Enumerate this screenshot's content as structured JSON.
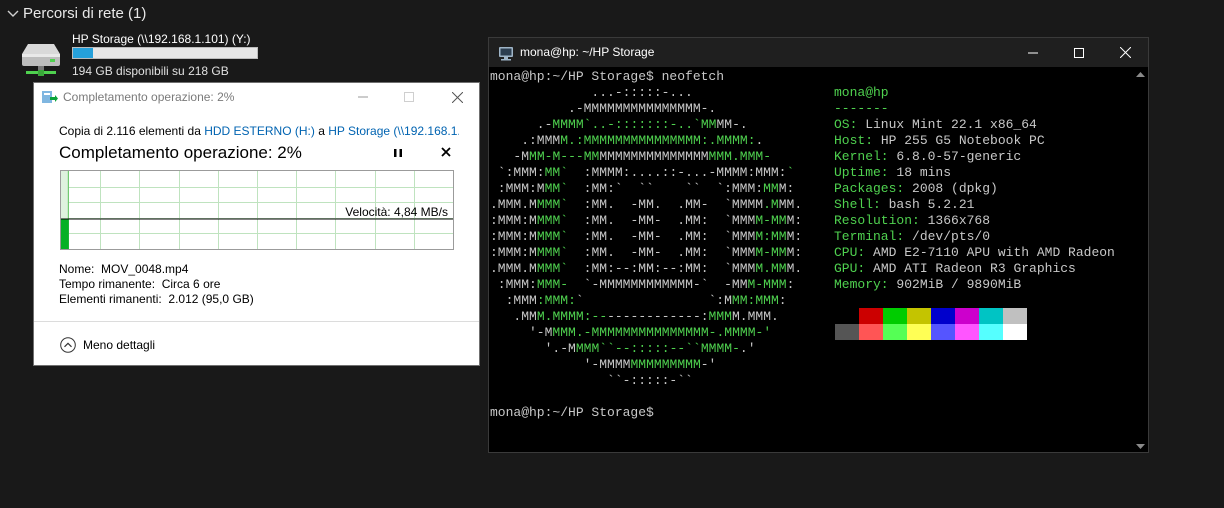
{
  "explorer": {
    "section_title": "Percorsi di rete (1)",
    "drive": {
      "name": "HP Storage (\\\\192.168.1.101) (Y:)",
      "free_text": "194 GB disponibili su 218 GB",
      "used_fraction": 0.11,
      "bar_color": "#26a0da"
    }
  },
  "copy_dialog": {
    "title": "Completamento operazione: 2%",
    "copy_prefix": "Copia di 2.116 elementi da ",
    "source": "HDD ESTERNO (H:)",
    "middle": " a ",
    "destination": "HP Storage (\\\\192.168.1....",
    "progress_title": "Completamento operazione: 2%",
    "progress_percent": 2,
    "speed": "Velocità: 4,84 MB/s",
    "details": {
      "name_label": "Nome:",
      "name_value": "MOV_0048.mp4",
      "time_label": "Tempo rimanente:",
      "time_value": "Circa 6 ore",
      "items_label": "Elementi rimanenti:",
      "items_value": "2.012 (95,0 GB)"
    },
    "less_details": "Meno dettagli",
    "graph_color": "#06b025"
  },
  "terminal": {
    "title": "mona@hp: ~/HP Storage",
    "prompt": "mona@hp:~/HP Storage$",
    "command": " neofetch",
    "logo": [
      "             ...-:::::-...",
      "          .-MMMMMMMMMMMMMMM-.",
      "      .-MMMM`..-:::::::-..`MMMM-.",
      "    .:MMMM.:MMMMMMMMMMMMMMM:.MMMM:.",
      "   -MMM-M---MMMMMMMMMMMMMMMMMMM.MMM-",
      " `:MMM:MM`  :MMMM:....::-...-MMMM:MMM:`",
      " :MMM:MMM`  :MM:`  ``    ``  `:MMM:MMM:",
      ".MMM.MMMM`  :MM.  -MM.  .MM-  `MMMM.MMM.",
      ":MMM:MMMM`  :MM.  -MM-  .MM:  `MMMM-MMM:",
      ":MMM:MMMM`  :MM.  -MM-  .MM:  `MMMM:MMM:",
      ":MMM:MMMM`  :MM.  -MM-  .MM:  `MMMM-MMM:",
      ".MMM.MMMM`  :MM:--:MM:--:MM:  `MMMM.MMM.",
      " :MMM:MMM-  `-MMMMMMMMMMMM-`  -MMM-MMM:",
      "  :MMM:MMM:`                `:MMM:MMM:",
      "   .MMM.MMMM:--------------:MMMM.MMM.",
      "     '-MMMM.-MMMMMMMMMMMMMMM-.MMMM-'",
      "       '.-MMMM``--:::::--``MMMM-.'",
      "            '-MMMMMMMMMMMMM-'",
      "               ``-:::::-``"
    ],
    "info": {
      "user_host": "mona@hp",
      "separator": "-------",
      "rows": [
        {
          "key": "OS",
          "value": " Linux Mint 22.1 x86_64"
        },
        {
          "key": "Host",
          "value": " HP 255 G5 Notebook PC"
        },
        {
          "key": "Kernel",
          "value": " 6.8.0-57-generic"
        },
        {
          "key": "Uptime",
          "value": " 18 mins"
        },
        {
          "key": "Packages",
          "value": " 2008 (dpkg)"
        },
        {
          "key": "Shell",
          "value": " bash 5.2.21"
        },
        {
          "key": "Resolution",
          "value": " 1366x768"
        },
        {
          "key": "Terminal",
          "value": " /dev/pts/0"
        },
        {
          "key": "CPU",
          "value": " AMD E2-7110 APU with AMD Radeon"
        },
        {
          "key": "GPU",
          "value": " AMD ATI Radeon R3 Graphics"
        },
        {
          "key": "Memory",
          "value": " 902MiB / 9890MiB"
        }
      ]
    },
    "palette_top": [
      "#000000",
      "#cc0000",
      "#00cc00",
      "#c4c400",
      "#0000cc",
      "#cc00cc",
      "#00c4c4",
      "#c0c0c0"
    ],
    "palette_bottom": [
      "#555555",
      "#ff5555",
      "#55ff55",
      "#ffff55",
      "#5555ff",
      "#ff55ff",
      "#55ffff",
      "#ffffff"
    ],
    "final_prompt": "mona@hp:~/HP Storage$",
    "accent": "#4fd14f"
  }
}
